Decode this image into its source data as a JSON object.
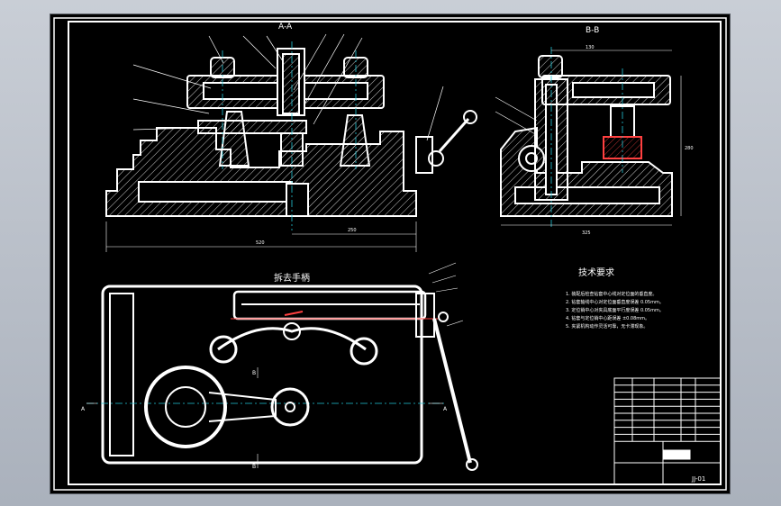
{
  "sections": {
    "front_view": "A-A",
    "side_view": "B-B",
    "plan_view": "拆去手柄",
    "cut_a_left": "A",
    "cut_a_right": "A",
    "cut_b_top": "B",
    "cut_b_bottom": "B"
  },
  "tech_requirements": {
    "title": "技术要求",
    "items": [
      "1. 装配后检查钻套中心线对定位面的垂直度。",
      "2. 钻套轴线中心对定位面垂直度误差 0.05mm。",
      "3. 定位销中心对夹具底面平行度误差 0.05mm。",
      "4. 钻套与定位销中心距误差 ±0.08mm。",
      "5. 夹紧机构动作灵活可靠，无卡滞现象。"
    ]
  },
  "dimensions": {
    "front_total": "520",
    "front_partial": "250",
    "side_width": "130",
    "side_height": "280",
    "side_total": "325"
  },
  "title_block": {
    "drawing_number": "JJ-01"
  },
  "colors": {
    "line": "#ffffff",
    "center": "#22c6d6",
    "leader": "#ff4040",
    "background": "#000000"
  }
}
